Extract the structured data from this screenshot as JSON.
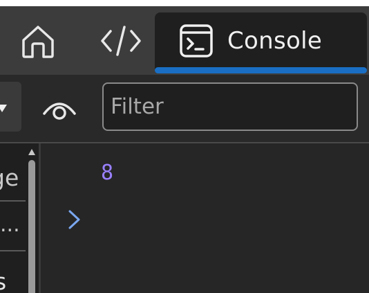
{
  "tabs": {
    "home": {
      "icon": "home-icon"
    },
    "elements": {
      "icon": "code-icon"
    },
    "console": {
      "icon": "console-icon",
      "label": "Console",
      "active": true
    }
  },
  "toolbar": {
    "sidebar_toggle_icon": "caret-down-icon",
    "live_expression_icon": "eye-icon",
    "filter": {
      "placeholder": "Filter",
      "value": ""
    }
  },
  "sidebar": {
    "items": [
      {
        "label": "ge"
      },
      {
        "label": "..."
      },
      {
        "label": "s"
      }
    ]
  },
  "console": {
    "result": "8",
    "prompt_icon": "chevron-right-icon"
  },
  "colors": {
    "accent": "#1a6fc4",
    "result_number": "#9980ff",
    "prompt": "#7aa7f0",
    "background": "#292929"
  }
}
